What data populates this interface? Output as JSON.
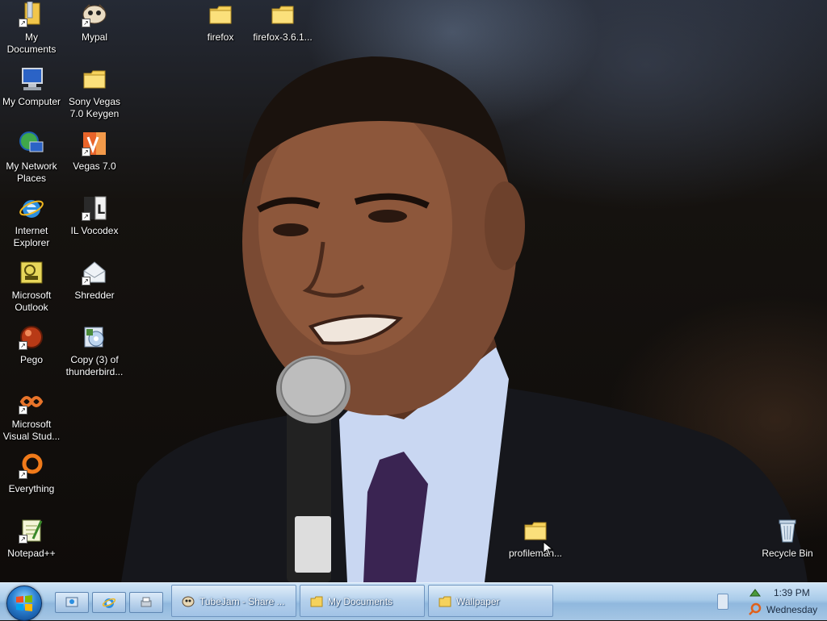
{
  "desktop": {
    "icons": [
      {
        "id": "my-documents",
        "label": "My\nDocuments",
        "icon": "folder-documents-icon"
      },
      {
        "id": "mypal",
        "label": "Mypal",
        "icon": "mypal-icon"
      },
      {
        "id": "firefox-folder",
        "label": "firefox",
        "icon": "folder-icon"
      },
      {
        "id": "firefox-361-folder",
        "label": "firefox-3.6.1...",
        "icon": "folder-icon"
      },
      {
        "id": "my-computer",
        "label": "My Computer",
        "icon": "computer-icon"
      },
      {
        "id": "sony-vegas-keygen",
        "label": "Sony Vegas\n7.0 Keygen",
        "icon": "folder-icon"
      },
      {
        "id": "my-network-places",
        "label": "My Network\nPlaces",
        "icon": "network-icon"
      },
      {
        "id": "vegas-7",
        "label": "Vegas 7.0",
        "icon": "vegas-icon"
      },
      {
        "id": "internet-explorer",
        "label": "Internet\nExplorer",
        "icon": "ie-icon"
      },
      {
        "id": "il-vocodex",
        "label": "IL Vocodex",
        "icon": "vocodex-icon"
      },
      {
        "id": "microsoft-outlook",
        "label": "Microsoft\nOutlook",
        "icon": "outlook-icon"
      },
      {
        "id": "shredder",
        "label": "Shredder",
        "icon": "shredder-icon"
      },
      {
        "id": "pego",
        "label": "Pego",
        "icon": "pego-icon"
      },
      {
        "id": "thunderbird-copy",
        "label": "Copy (3) of\nthunderbird...",
        "icon": "installer-icon"
      },
      {
        "id": "visual-studio",
        "label": "Microsoft\nVisual Stud...",
        "icon": "visual-studio-icon"
      },
      {
        "id": "everything",
        "label": "Everything",
        "icon": "everything-icon"
      },
      {
        "id": "notepad-plus-plus",
        "label": "Notepad++",
        "icon": "notepad-plus-plus-icon"
      },
      {
        "id": "profileman",
        "label": "profileman...",
        "icon": "folder-icon"
      },
      {
        "id": "recycle-bin",
        "label": "Recycle Bin",
        "icon": "recycle-bin-icon"
      }
    ]
  },
  "taskbar": {
    "quick_launch": [
      {
        "id": "show-desktop",
        "icon": "show-desktop-icon"
      },
      {
        "id": "ie",
        "icon": "ie-icon"
      },
      {
        "id": "app",
        "icon": "printer-icon"
      }
    ],
    "tasks": [
      {
        "id": "tubejam",
        "label": "TubeJam - Share ...",
        "icon": "tubejam-icon"
      },
      {
        "id": "my-documents",
        "label": "My Documents",
        "icon": "folder-icon"
      },
      {
        "id": "wallpaper",
        "label": "Wallpaper",
        "icon": "folder-icon"
      }
    ],
    "clock": {
      "time": "1:39 PM",
      "day": "Wednesday"
    }
  },
  "colors": {
    "taskbar": "#a9cbe9",
    "folder": "#f5d35a",
    "label": "#ffffff"
  }
}
